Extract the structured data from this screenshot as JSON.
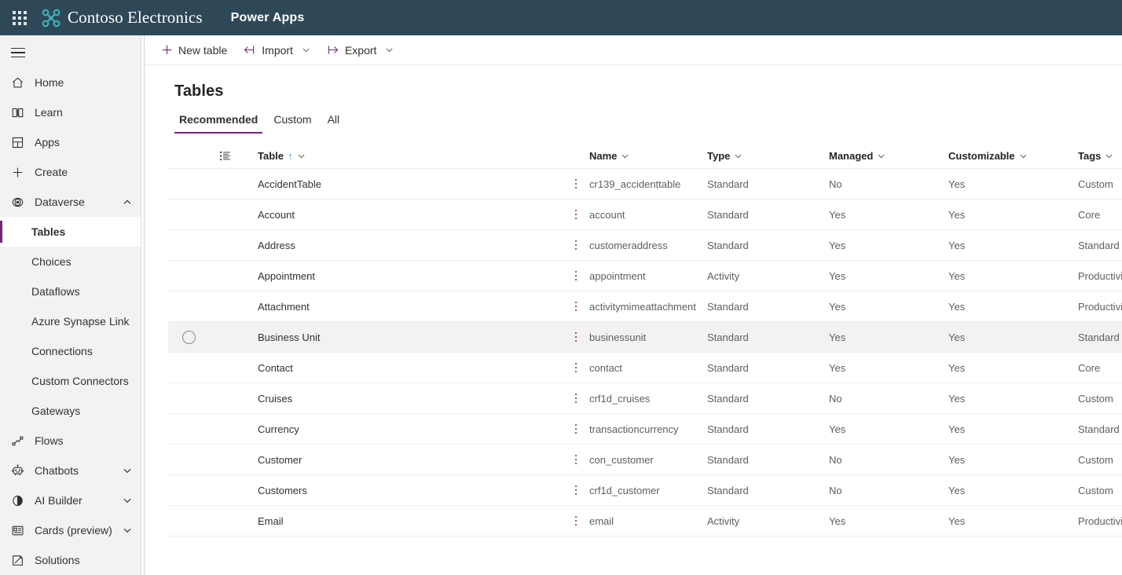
{
  "topbar": {
    "waffle_label": "app-launcher",
    "brand": "Contoso Electronics",
    "app": "Power Apps"
  },
  "commandbar": {
    "new_table": "New table",
    "import": "Import",
    "export": "Export"
  },
  "page": {
    "title": "Tables",
    "tabs": [
      {
        "label": "Recommended",
        "active": true
      },
      {
        "label": "Custom",
        "active": false
      },
      {
        "label": "All",
        "active": false
      }
    ]
  },
  "sidebar": {
    "items": [
      {
        "label": "Home",
        "icon": "home-icon",
        "level": 0,
        "chevron": "",
        "selected": false
      },
      {
        "label": "Learn",
        "icon": "book-icon",
        "level": 0,
        "chevron": "",
        "selected": false
      },
      {
        "label": "Apps",
        "icon": "apps-icon",
        "level": 0,
        "chevron": "",
        "selected": false
      },
      {
        "label": "Create",
        "icon": "plus-icon",
        "level": 0,
        "chevron": "",
        "selected": false
      },
      {
        "label": "Dataverse",
        "icon": "dataverse-icon",
        "level": 0,
        "chevron": "up",
        "selected": false
      },
      {
        "label": "Tables",
        "icon": "",
        "level": 1,
        "chevron": "",
        "selected": true
      },
      {
        "label": "Choices",
        "icon": "",
        "level": 1,
        "chevron": "",
        "selected": false
      },
      {
        "label": "Dataflows",
        "icon": "",
        "level": 1,
        "chevron": "",
        "selected": false
      },
      {
        "label": "Azure Synapse Link",
        "icon": "",
        "level": 1,
        "chevron": "",
        "selected": false
      },
      {
        "label": "Connections",
        "icon": "",
        "level": 1,
        "chevron": "",
        "selected": false
      },
      {
        "label": "Custom Connectors",
        "icon": "",
        "level": 1,
        "chevron": "",
        "selected": false
      },
      {
        "label": "Gateways",
        "icon": "",
        "level": 1,
        "chevron": "",
        "selected": false
      },
      {
        "label": "Flows",
        "icon": "flows-icon",
        "level": 0,
        "chevron": "",
        "selected": false
      },
      {
        "label": "Chatbots",
        "icon": "bot-icon",
        "level": 0,
        "chevron": "down",
        "selected": false
      },
      {
        "label": "AI Builder",
        "icon": "ai-icon",
        "level": 0,
        "chevron": "down",
        "selected": false
      },
      {
        "label": "Cards (preview)",
        "icon": "cards-icon",
        "level": 0,
        "chevron": "down",
        "selected": false
      },
      {
        "label": "Solutions",
        "icon": "solutions-icon",
        "level": 0,
        "chevron": "",
        "selected": false
      }
    ]
  },
  "grid": {
    "columns": [
      {
        "key": "table",
        "label": "Table",
        "sorted": "asc"
      },
      {
        "key": "name",
        "label": "Name",
        "sorted": ""
      },
      {
        "key": "type",
        "label": "Type",
        "sorted": ""
      },
      {
        "key": "managed",
        "label": "Managed",
        "sorted": ""
      },
      {
        "key": "customizable",
        "label": "Customizable",
        "sorted": ""
      },
      {
        "key": "tags",
        "label": "Tags",
        "sorted": ""
      }
    ],
    "rows": [
      {
        "table": "AccidentTable",
        "name": "cr139_accidenttable",
        "type": "Standard",
        "managed": "No",
        "customizable": "Yes",
        "tags": "Custom",
        "hovered": false
      },
      {
        "table": "Account",
        "name": "account",
        "type": "Standard",
        "managed": "Yes",
        "customizable": "Yes",
        "tags": "Core",
        "hovered": false
      },
      {
        "table": "Address",
        "name": "customeraddress",
        "type": "Standard",
        "managed": "Yes",
        "customizable": "Yes",
        "tags": "Standard",
        "hovered": false
      },
      {
        "table": "Appointment",
        "name": "appointment",
        "type": "Activity",
        "managed": "Yes",
        "customizable": "Yes",
        "tags": "Productivity",
        "hovered": false
      },
      {
        "table": "Attachment",
        "name": "activitymimeattachment",
        "type": "Standard",
        "managed": "Yes",
        "customizable": "Yes",
        "tags": "Productivity",
        "hovered": false
      },
      {
        "table": "Business Unit",
        "name": "businessunit",
        "type": "Standard",
        "managed": "Yes",
        "customizable": "Yes",
        "tags": "Standard",
        "hovered": true
      },
      {
        "table": "Contact",
        "name": "contact",
        "type": "Standard",
        "managed": "Yes",
        "customizable": "Yes",
        "tags": "Core",
        "hovered": false
      },
      {
        "table": "Cruises",
        "name": "crf1d_cruises",
        "type": "Standard",
        "managed": "No",
        "customizable": "Yes",
        "tags": "Custom",
        "hovered": false
      },
      {
        "table": "Currency",
        "name": "transactioncurrency",
        "type": "Standard",
        "managed": "Yes",
        "customizable": "Yes",
        "tags": "Standard",
        "hovered": false
      },
      {
        "table": "Customer",
        "name": "con_customer",
        "type": "Standard",
        "managed": "No",
        "customizable": "Yes",
        "tags": "Custom",
        "hovered": false
      },
      {
        "table": "Customers",
        "name": "crf1d_customer",
        "type": "Standard",
        "managed": "No",
        "customizable": "Yes",
        "tags": "Custom",
        "hovered": false
      },
      {
        "table": "Email",
        "name": "email",
        "type": "Activity",
        "managed": "Yes",
        "customizable": "Yes",
        "tags": "Productivity",
        "hovered": false
      }
    ]
  },
  "colors": {
    "topbar_bg": "#2f4858",
    "accent_purple": "#742774",
    "logo_teal": "#3fb1b8",
    "sort_teal": "#4a9bb5",
    "sidebar_bg": "#f3f2f1"
  }
}
